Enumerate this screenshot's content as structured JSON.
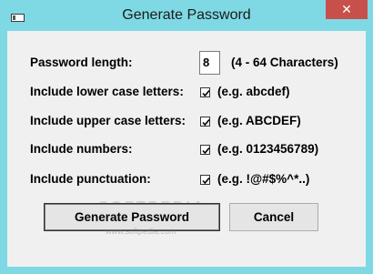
{
  "window": {
    "title": "Generate Password",
    "close_glyph": "✕"
  },
  "form": {
    "length_label": "Password length:",
    "length_value": "8",
    "length_hint": "(4 - 64 Characters)",
    "options": [
      {
        "label": "Include lower case letters:",
        "checked": true,
        "example": "(e.g. abcdef)"
      },
      {
        "label": "Include upper case letters:",
        "checked": true,
        "example": "(e.g. ABCDEF)"
      },
      {
        "label": "Include numbers:",
        "checked": true,
        "example": "(e.g. 0123456789)"
      },
      {
        "label": "Include punctuation:",
        "checked": true,
        "example": "(e.g. !@#$%^*..)"
      }
    ]
  },
  "buttons": {
    "generate": "Generate Password",
    "cancel": "Cancel"
  },
  "watermark": {
    "text": "SOFTPEDIA",
    "url": "www.softpedia.com"
  }
}
